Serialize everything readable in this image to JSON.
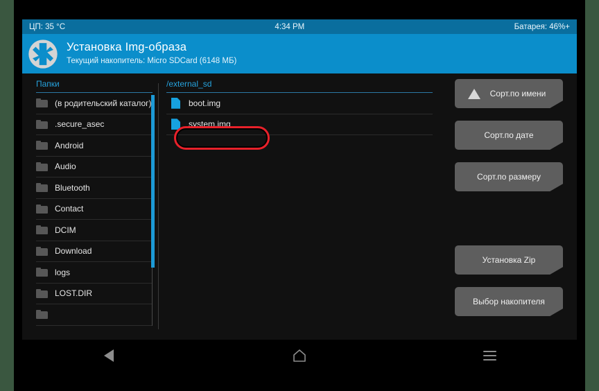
{
  "status_bar": {
    "cpu_temp": "ЦП: 35 °C",
    "clock": "4:34 PM",
    "battery": "Батарея: 46%+"
  },
  "header": {
    "logo_icon": "twrp-logo-icon",
    "title": "Установка Img-образа",
    "subtitle": "Текущий накопитель: Micro SDCard (6148 МБ)"
  },
  "folders_pane": {
    "label": "Папки",
    "items": [
      {
        "icon": "folder-icon",
        "name": "(в родительский каталог)"
      },
      {
        "icon": "folder-icon",
        "name": ".secure_asec"
      },
      {
        "icon": "folder-icon",
        "name": "Android"
      },
      {
        "icon": "folder-icon",
        "name": "Audio"
      },
      {
        "icon": "folder-icon",
        "name": "Bluetooth"
      },
      {
        "icon": "folder-icon",
        "name": "Contact"
      },
      {
        "icon": "folder-icon",
        "name": "DCIM"
      },
      {
        "icon": "folder-icon",
        "name": "Download"
      },
      {
        "icon": "folder-icon",
        "name": "logs"
      },
      {
        "icon": "folder-icon",
        "name": "LOST.DIR"
      },
      {
        "icon": "folder-icon",
        "name": ""
      }
    ]
  },
  "files_pane": {
    "path": "/external_sd",
    "items": [
      {
        "icon": "file-icon",
        "name": "boot.img"
      },
      {
        "icon": "file-icon",
        "name": "system.img"
      }
    ]
  },
  "buttons": [
    {
      "label": "Сорт.по имени",
      "icon": "sort-ascending-triangle-icon"
    },
    {
      "label": "Сорт.по дате",
      "icon": ""
    },
    {
      "label": "Сорт.по размеру",
      "icon": ""
    },
    {
      "label": "Установка Zip",
      "icon": ""
    },
    {
      "label": "Выбор накопителя",
      "icon": ""
    }
  ],
  "annotation": {
    "target": "system.img",
    "color": "#e8212a",
    "shape": "rounded-rectangle-outline"
  },
  "nav_bar": {
    "back": "back-triangle-icon",
    "home": "home-house-icon",
    "recents": "recents-menu-icon"
  },
  "colors": {
    "accent_blue": "#0b8ecb",
    "status_blue": "#0a6e9e",
    "scrollbar_blue": "#1c9ad6",
    "file_icon_blue": "#17a2e0",
    "button_gray": "#5e5e5e",
    "background_black": "#111111",
    "annotation_red": "#e8212a"
  }
}
